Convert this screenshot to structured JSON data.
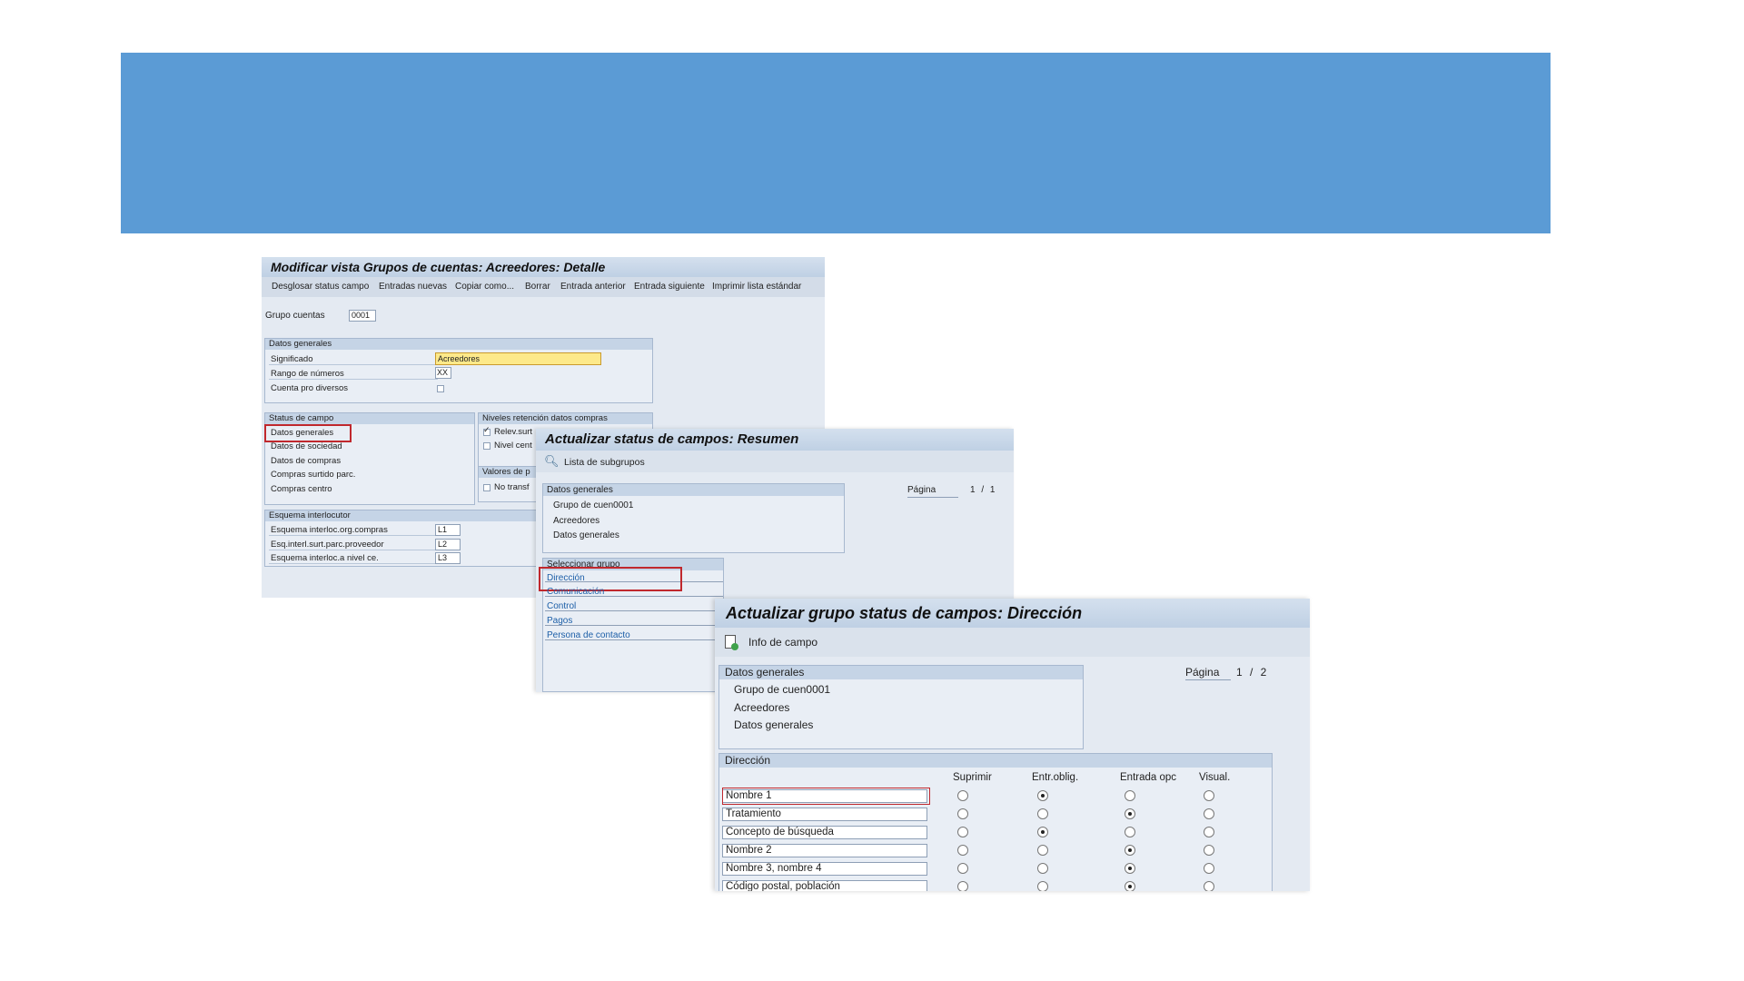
{
  "colors": {
    "banner": "#5b9bd5",
    "panel": "#e4eaf2",
    "highlight_border": "#c0282d",
    "link": "#1d5fa8"
  },
  "win1": {
    "title": "Modificar vista Grupos de cuentas: Acreedores: Detalle",
    "toolbar": [
      "Desglosar status campo",
      "Entradas nuevas",
      "Copiar como...",
      "Borrar",
      "Entrada anterior",
      "Entrada siguiente",
      "Imprimir lista estándar"
    ],
    "grupo_label": "Grupo cuentas",
    "grupo_value": "0001",
    "datos_generales": {
      "header": "Datos generales",
      "significado_label": "Significado",
      "significado_value": "Acreedores",
      "rango_label": "Rango de números",
      "rango_value": "XX",
      "cuenta_label": "Cuenta pro diversos"
    },
    "status_campo": {
      "header": "Status de campo",
      "items": [
        "Datos generales",
        "Datos de sociedad",
        "Datos de compras",
        "Compras surtido parc.",
        "Compras centro"
      ]
    },
    "niveles": {
      "header": "Niveles retención datos compras",
      "item1": "Relev.surt",
      "item2": "Nivel cent"
    },
    "valores": {
      "header": "Valores de p",
      "item1": "No transf"
    },
    "esquema": {
      "header": "Esquema interlocutor",
      "rows": [
        {
          "label": "Esquema interloc.org.compras",
          "value": "L1"
        },
        {
          "label": "Esq.interl.surt.parc.proveedor",
          "value": "L2"
        },
        {
          "label": "Esquema interloc.a nivel ce.",
          "value": "L3"
        }
      ]
    }
  },
  "win2": {
    "title": "Actualizar status de campos: Resumen",
    "toolbar_button": "Lista de subgrupos",
    "datos_header": "Datos generales",
    "datos_lines": [
      "Grupo de cuen0001",
      "Acreedores",
      "Datos generales"
    ],
    "pagina_label": "Página",
    "pagina_value": "1 / 1",
    "select_header": "Seleccionar grupo",
    "groups": [
      "Dirección",
      "Comunicación",
      "Control",
      "Pagos",
      "Persona de contacto"
    ]
  },
  "win3": {
    "title": "Actualizar grupo status de campos: Dirección",
    "toolbar_button": "Info de campo",
    "datos_header": "Datos generales",
    "datos_lines": [
      "Grupo de cuen0001",
      "Acreedores",
      "Datos generales"
    ],
    "pagina_label": "Página",
    "pagina_value": "1 / 2",
    "dir_header": "Dirección",
    "columns": [
      "Suprimir",
      "Entr.oblig.",
      "Entrada opc",
      "Visual."
    ],
    "rows": [
      {
        "name": "Nombre 1",
        "selected": 1
      },
      {
        "name": "Tratamiento",
        "selected": 2
      },
      {
        "name": "Concepto de búsqueda",
        "selected": 1
      },
      {
        "name": "Nombre 2",
        "selected": 2
      },
      {
        "name": "Nombre 3, nombre 4",
        "selected": 2
      },
      {
        "name": "Código postal, población",
        "selected": 2
      }
    ]
  }
}
